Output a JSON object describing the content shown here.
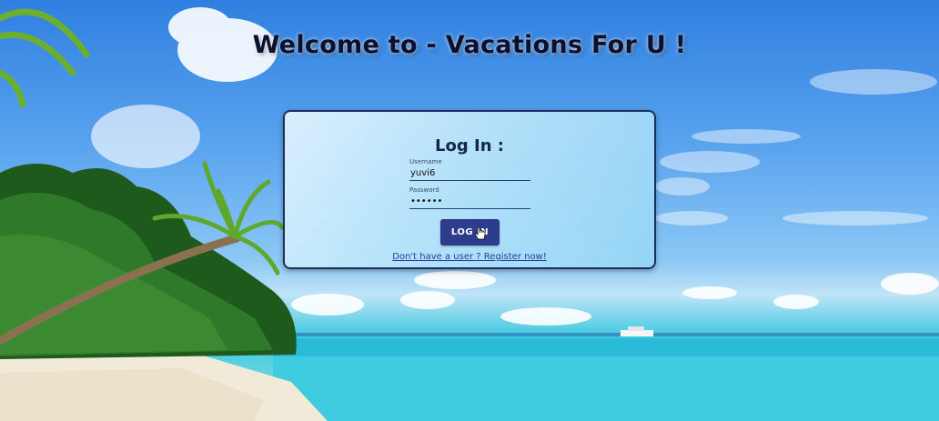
{
  "header": {
    "title": "Welcome to - Vacations For U !"
  },
  "login": {
    "heading": "Log In :",
    "username_label": "Username",
    "username_value": "yuvi6",
    "password_label": "Password",
    "password_value": "••••••",
    "button_label": "LOG IN",
    "register_link": "Don't have a user ? Register now!"
  },
  "colors": {
    "button": "#2d3c8c",
    "card_border": "#1d2f5c",
    "link": "#2a3a9a"
  }
}
